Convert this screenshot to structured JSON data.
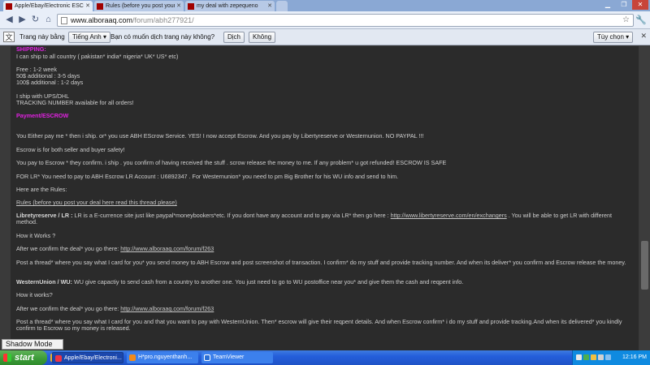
{
  "browser": {
    "tabs": [
      {
        "title": "Apple/Ebay/Electronic ESCR"
      },
      {
        "title": "Rules (before you post your"
      },
      {
        "title": "my deal with zepequeno"
      }
    ],
    "url_host": "www.alboraaq.com",
    "url_path": "/forum/abh277921/"
  },
  "translate_bar": {
    "label": "Trang này bằng",
    "language_select": "Tiếng Anh",
    "question": "Bạn có muốn dịch trang này không?",
    "translate_btn": "Dịch",
    "decline_btn": "Không",
    "options_btn": "Tùy chọn"
  },
  "page": {
    "shipping_heading": "SHIPPING:",
    "ship_countries": "I can ship to all country ( pakistan* india* nigeria* UK* US* etc)",
    "free": "Free : 1-2 week",
    "add50": "50$ additional : 3-5 days",
    "add100": "100$ additional : 1-2 days",
    "ship_ups": "I ship with UPS/DHL",
    "tracking": "TRACKING NUMBER available for all orders!",
    "payment_heading": "Payment/ESCROW",
    "pay_options": "You Either pay me * then i ship. or* you use ABH EScrow Service. YES! I now accept Escrow. And you pay by Libertyreserve or Westernunion. NO PAYPAL !!!",
    "escrow_both": "Escrow is for both seller and buyer safety!",
    "pay_to_escrow": "You pay to Escrow * they confirm. i ship . you confirm of having received the stuff . scrow release the money to me. If any problem* u got refunded! ESCROW IS SAFE",
    "lr_account": "FOR LR* You need to pay to ABH Escrow LR Account : U6892347 . For Westernunion* you need to pm Big Brother for his WU info and send to him.",
    "rules_here": "Here are the Rules:",
    "rules_link": "Rules (before you post your deal here read this thread please)",
    "lr_label": "Libretyreserve / LR :",
    "lr_desc": " LR is a E-currence site just like paypal*moneybookers*etc. If you dont have any account and to pay via LR* then go here :",
    "lr_link": "http://www.libertyreserve.com/en/exchangers",
    "lr_desc_end": ". You will be able to get LR with different method.",
    "how_works_1": "How it Works ?",
    "after_confirm_1": "After we confirm the deal* you go there:",
    "forum_link_1": "http://www.alboraaq.com/forum/f263",
    "post_thread_1": "Post a thread* where you say what I card for you* you send money to ABH Escrow and post screenshot of transaction. I confirm* do my stuff and provide tracking number. And when its deliver* you confirm and Escrow release the money.",
    "wu_label": "WesternUnion / WU:",
    "wu_desc": " WU give capactiy to send cash from a country to another one. You just need to go to WU postoffice near you* and give them the cash and reqpent info.",
    "how_works_2": "How it works?",
    "after_confirm_2": "After we confirm the deal* you go there:",
    "forum_link_2": "http://www.alboraaq.com/forum/f263",
    "post_thread_2": "Post a thread* where you say what I card for you and that you want to pay with WesternUnion. Then* escrow will give their reqpent details. And when Escrow confirm* i do my stuff and provide tracking.And when its delivered* you kindly confirm to Escrow so my money is released."
  },
  "overlay": {
    "shadow_mode": "Shadow Mode"
  },
  "taskbar": {
    "start_label": "start",
    "tasks": [
      {
        "label": "Apple/Ebay/Electroni..."
      },
      {
        "label": "H*pro.nguyenthanh..."
      },
      {
        "label": "TeamViewer"
      }
    ],
    "clock": "12:16 PM"
  },
  "colors": {
    "heading": "#e021e0",
    "page_bg": "#2b2b2b",
    "taskbar": "#245edb",
    "start": "#3a9a36"
  }
}
